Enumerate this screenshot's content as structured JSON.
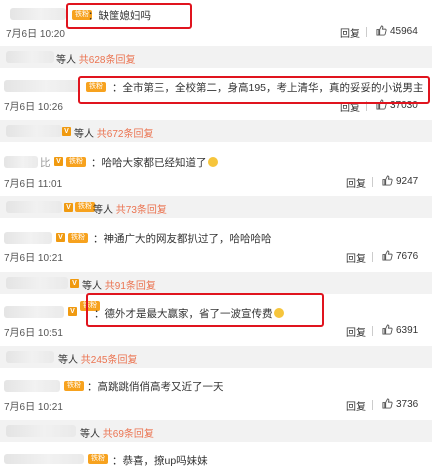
{
  "comments": [
    {
      "text": "：缺筐媳妇吗",
      "time": "7月6日 10:20",
      "reply": "回复",
      "likes": "45964"
    },
    {
      "text": "：全市第三，全校第二，身高195，考上清华，真的妥妥的小说男主",
      "time": "7月6日 10:26",
      "reply": "回复",
      "likes": "37030"
    },
    {
      "text": "：哈哈大家都已经知道了",
      "time": "7月6日 11:01",
      "reply": "回复",
      "likes": "9247"
    },
    {
      "text": "：神通广大的网友都扒过了，哈哈哈哈",
      "time": "7月6日 10:21",
      "reply": "回复",
      "likes": "7676"
    },
    {
      "text": "：德外才是最大赢家，省了一波宣传费",
      "time": "7月6日 10:51",
      "reply": "回复",
      "likes": "6391"
    },
    {
      "text": "：高跳跳俏俏高考又近了一天",
      "time": "7月6日 10:21",
      "reply": "回复",
      "likes": "3736"
    },
    {
      "text": "：恭喜，撩up吗妹妹",
      "time": "",
      "reply": "",
      "likes": ""
    }
  ],
  "sub_replies": [
    {
      "who": "等人",
      "count": "共628条回复"
    },
    {
      "who": "等人",
      "count": "共672条回复"
    },
    {
      "who": "等人",
      "count": "共73条回复"
    },
    {
      "who": "等人",
      "count": "共91条回复"
    },
    {
      "who": "等人",
      "count": "共245条回复"
    },
    {
      "who": "等人",
      "count": "共69条回复"
    }
  ],
  "badge_label": "铁粉",
  "icons": {
    "like": "thumbs-up-icon",
    "vip": "vip-v-icon",
    "fan": "fan-badge-icon"
  },
  "colors": {
    "highlight_box": "#e0141e",
    "reply_count": "#eb7350",
    "badge": "#f7a21e",
    "sub_bg": "#f2f2f2"
  }
}
